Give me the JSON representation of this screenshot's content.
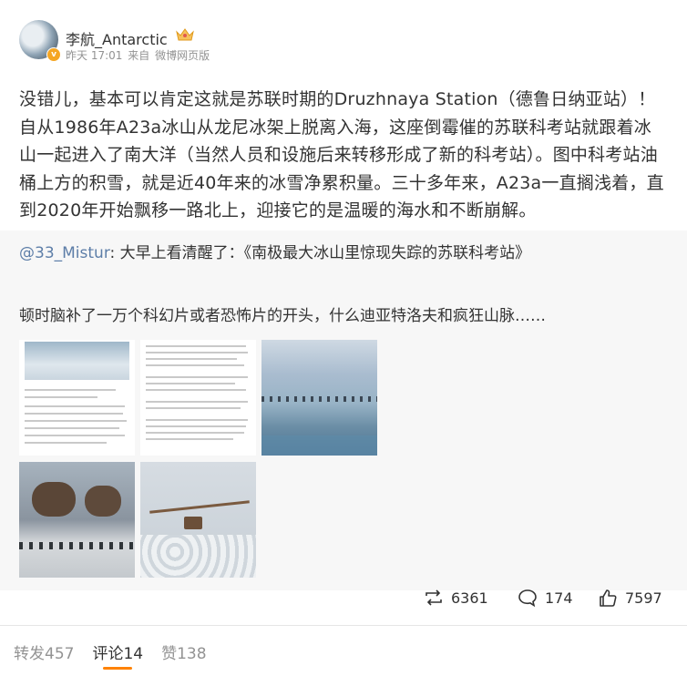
{
  "post": {
    "author": "李航_Antarctic",
    "time": "昨天 17:01",
    "source_prefix": "来自",
    "source": "微博网页版",
    "text": "没错儿，基本可以肯定这就是苏联时期的Druzhnaya Station（德鲁日纳亚站）！自从1986年A23a冰山从龙尼冰架上脱离入海，这座倒霉催的苏联科考站就跟着冰山一起进入了南大洋（当然人员和设施后来转移形成了新的科考站）。图中科考站油桶上方的积雪，就是近40年来的冰雪净累积量。三十多年来，A23a一直搁浅着，直到2020年开始飘移一路北上，迎接它的是温暖的海水和不断崩解。"
  },
  "repost": {
    "mention": "@33_Mistur",
    "text": ": 大早上看清醒了：《南极最大冰山里惊现失踪的苏联科考站》",
    "text2": "顿时脑补了一万个科幻片或者恐怖片的开头，什么迪亚特洛夫和疯狂山脉……",
    "images": [
      {
        "name": "news-screenshot-1"
      },
      {
        "name": "news-screenshot-2"
      },
      {
        "name": "iceberg-wall-photo"
      },
      {
        "name": "ice-tanks-photo"
      },
      {
        "name": "sea-ice-barrel-photo"
      }
    ],
    "actions": {
      "repost_count": "6361",
      "comment_count": "174",
      "like_count": "7597"
    }
  },
  "tabs": [
    {
      "label": "转发457"
    },
    {
      "label": "评论14"
    },
    {
      "label": "赞138"
    }
  ]
}
